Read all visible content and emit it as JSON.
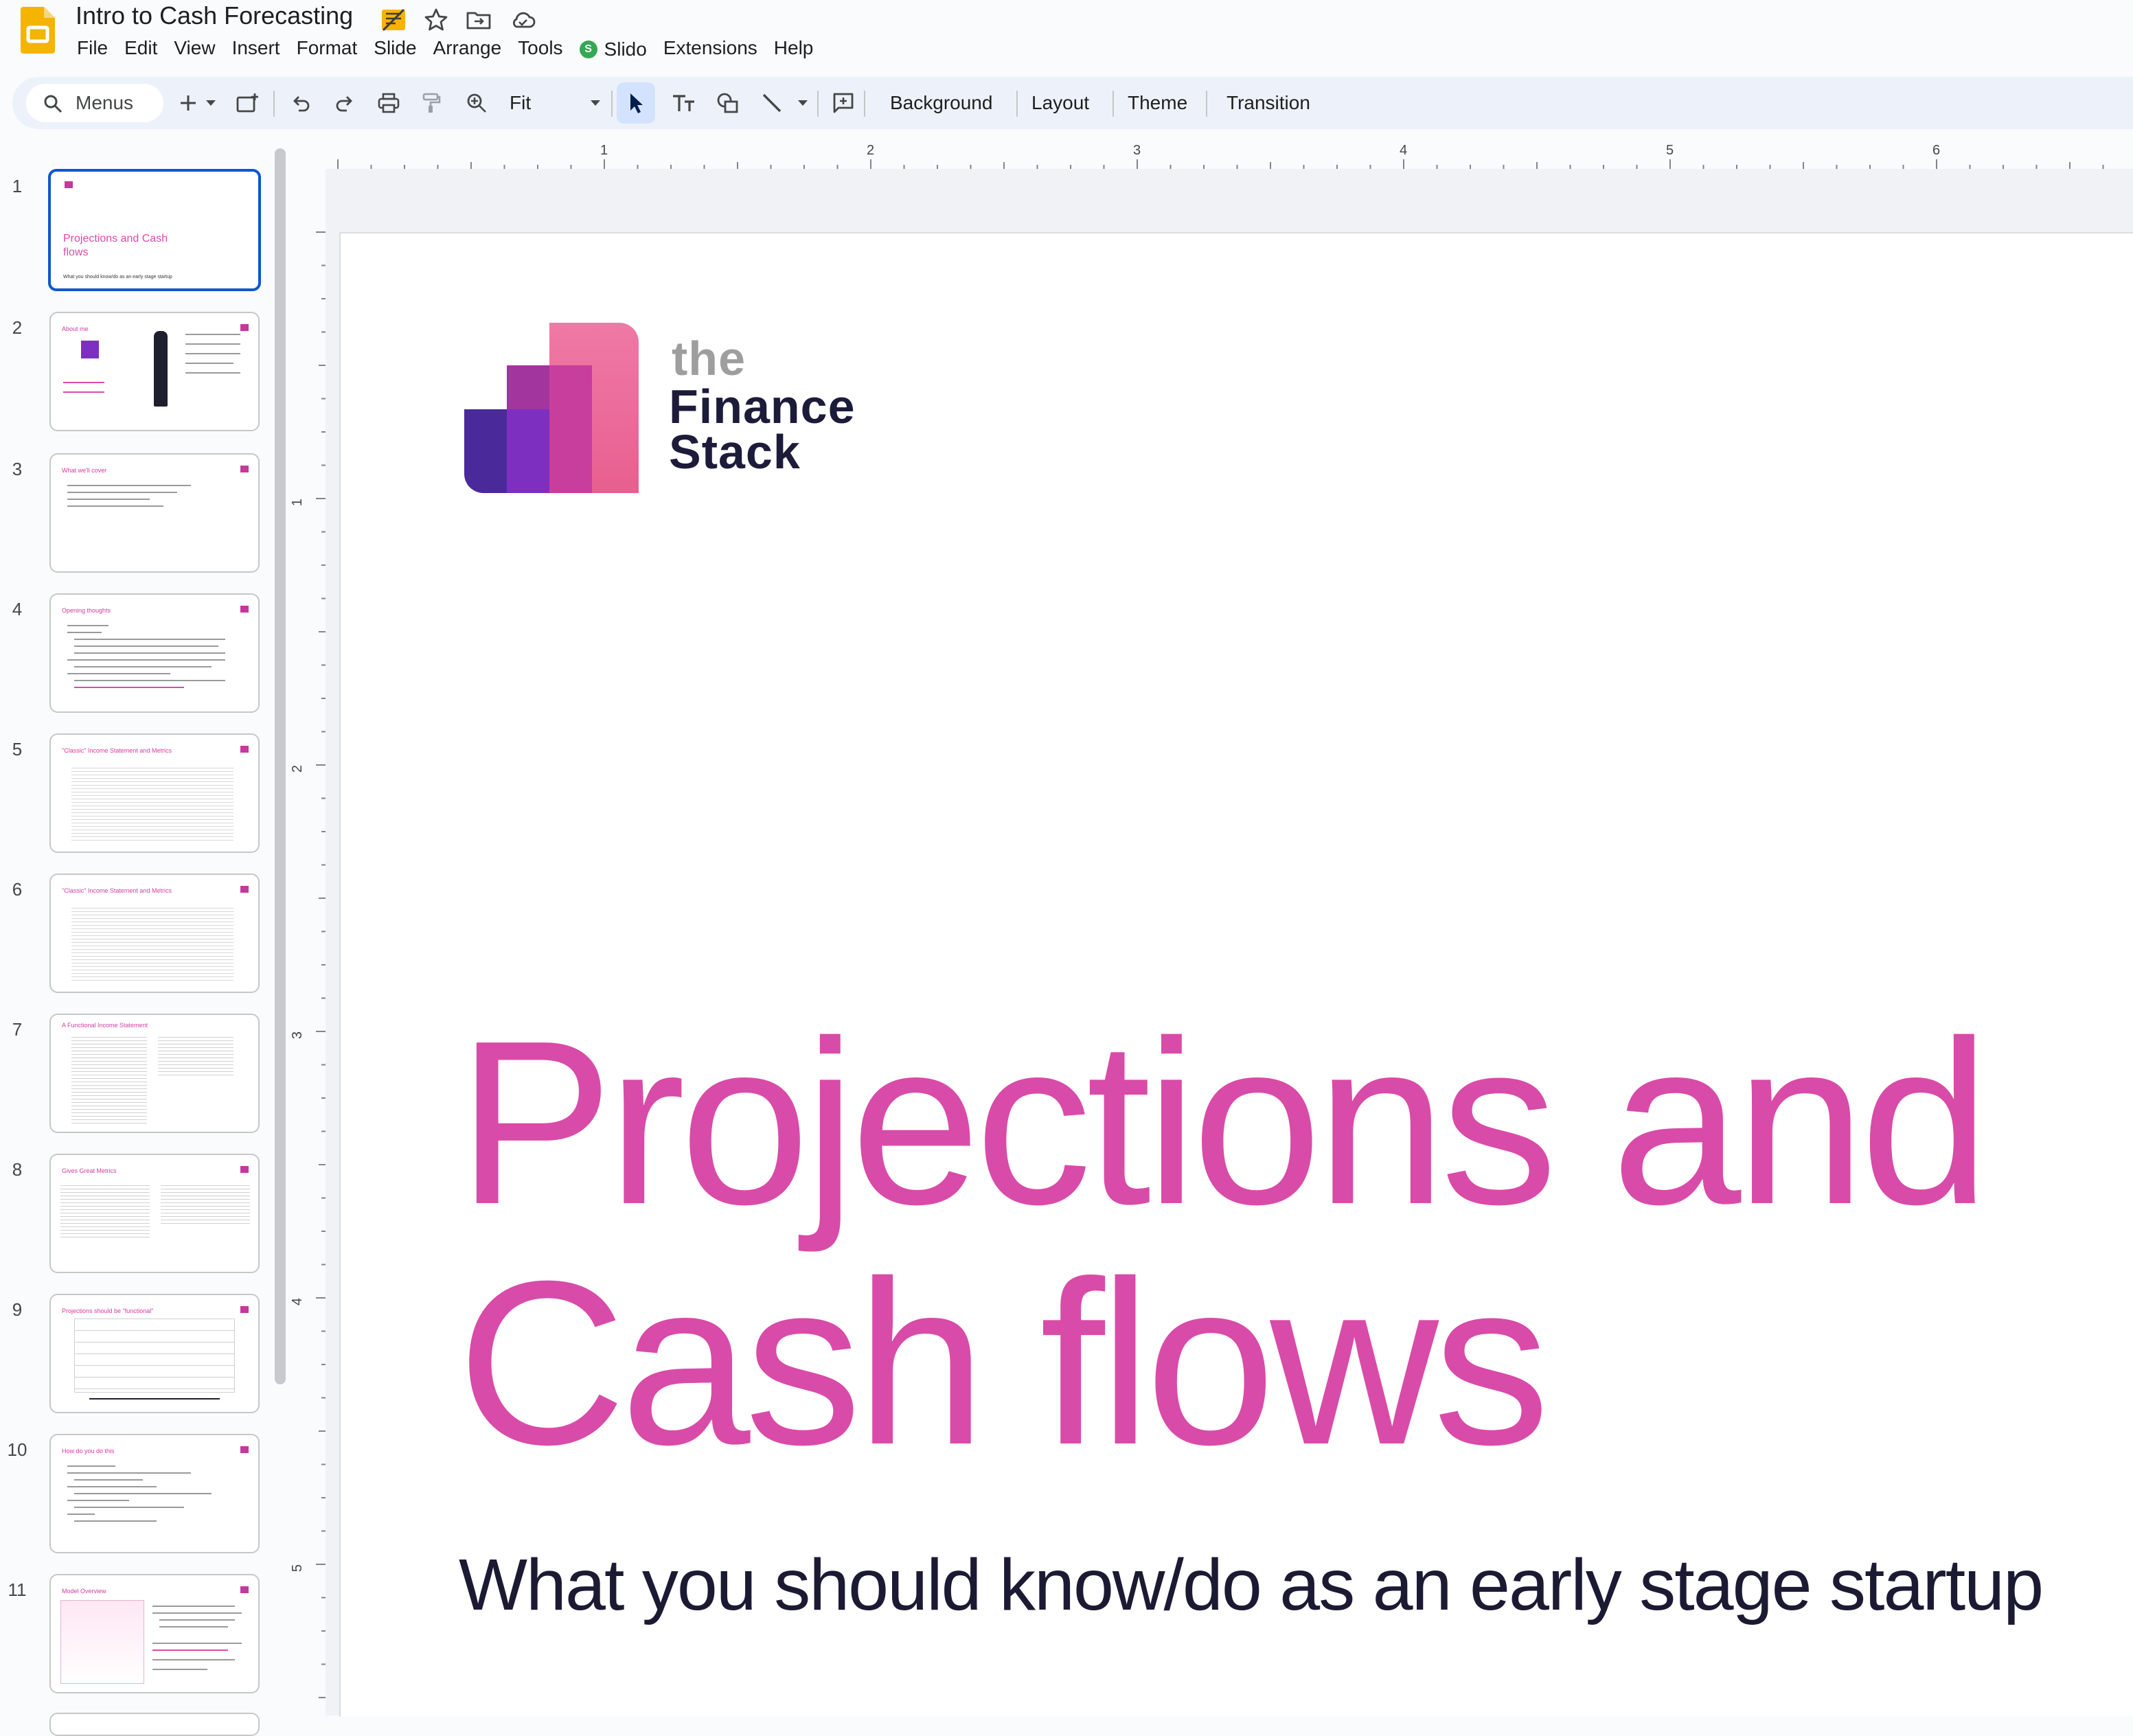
{
  "app": {
    "doc_title": "Intro to Cash Forecasting",
    "menus": [
      "File",
      "Edit",
      "View",
      "Insert",
      "Format",
      "Slide",
      "Arrange",
      "Tools",
      "Slido",
      "Extensions",
      "Help"
    ]
  },
  "toolbar": {
    "search_label": "Menus",
    "zoom_label": "Fit",
    "background_label": "Background",
    "layout_label": "Layout",
    "theme_label": "Theme",
    "transition_label": "Transition"
  },
  "ruler": {
    "horizontal_marks": [
      "1",
      "2",
      "3",
      "4",
      "5",
      "6"
    ],
    "vertical_marks": [
      "1",
      "2",
      "3",
      "4",
      "5"
    ]
  },
  "filmstrip": {
    "slides": [
      {
        "number": "1",
        "title": "Projections and Cash flows",
        "subtitle": "What you should know/do as an early stage startup"
      },
      {
        "number": "2",
        "title": "About me"
      },
      {
        "number": "3",
        "title": "What we'll cover"
      },
      {
        "number": "4",
        "title": "Opening thoughts"
      },
      {
        "number": "5",
        "title": "\"Classic\" Income Statement and Metrics"
      },
      {
        "number": "6",
        "title": "\"Classic\" Income Statement and Metrics"
      },
      {
        "number": "7",
        "title": "A Functional Income Statement"
      },
      {
        "number": "8",
        "title": "Gives Great Metrics"
      },
      {
        "number": "9",
        "title": "Projections should be \"functional\""
      },
      {
        "number": "10",
        "title": "How do you do this"
      },
      {
        "number": "11",
        "title": "Model Overview"
      }
    ]
  },
  "slide": {
    "logo_the": "the",
    "logo_finance": "Finance",
    "logo_stack": "Stack",
    "title_line1": "Projections and",
    "title_line2": "Cash flows",
    "subtitle": "What you should know/do as an early stage startup"
  },
  "colors": {
    "accent": "#d94ba8",
    "selection": "#0b57d0",
    "toolbar_bg": "#edf2fa",
    "logo_purple_dark": "#4a2a9a",
    "logo_purple": "#7d2fc0",
    "logo_magenta": "#c23a9a",
    "logo_pink": "#ef6d9a"
  }
}
